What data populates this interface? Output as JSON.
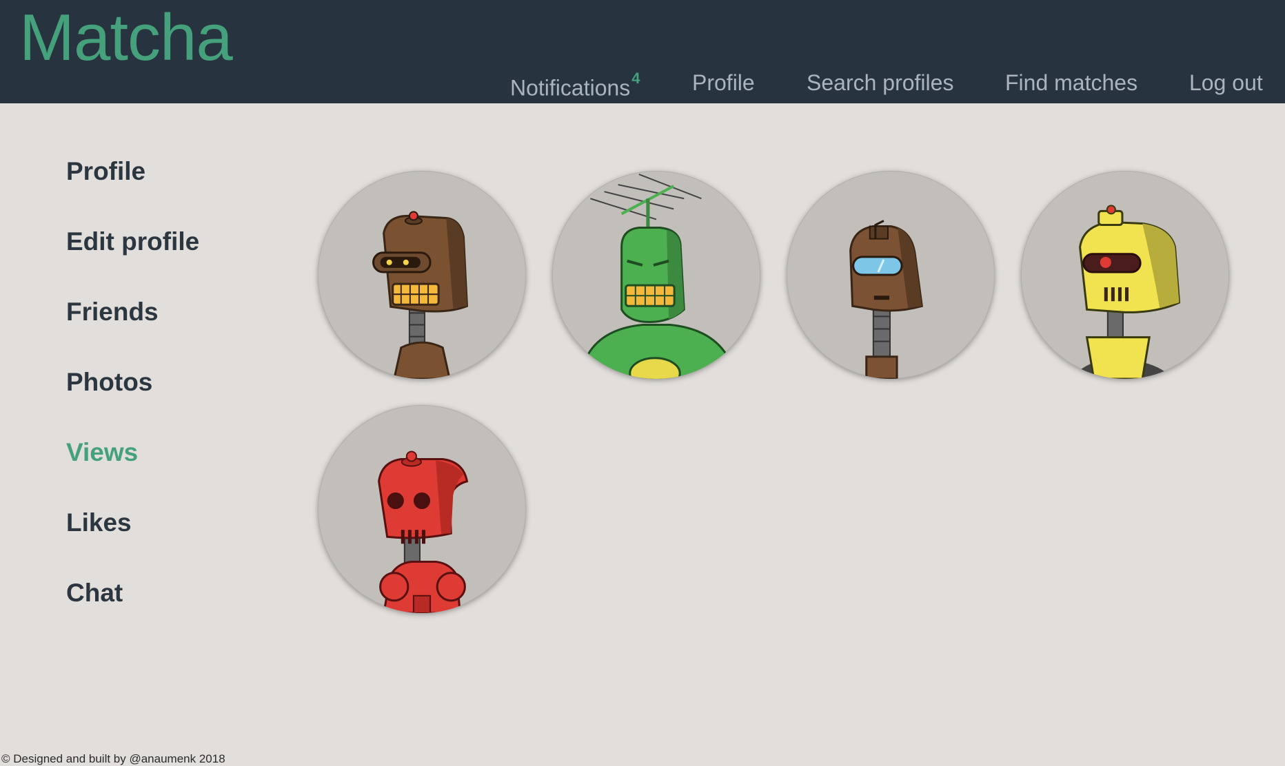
{
  "header": {
    "brand": "Matcha",
    "nav": {
      "notifications_label": "Notifications",
      "notifications_count": "4",
      "profile_label": "Profile",
      "search_label": "Search profiles",
      "find_matches_label": "Find matches",
      "logout_label": "Log out"
    }
  },
  "sidebar": {
    "items": [
      {
        "label": "Profile",
        "active": false
      },
      {
        "label": "Edit profile",
        "active": false
      },
      {
        "label": "Friends",
        "active": false
      },
      {
        "label": "Photos",
        "active": false
      },
      {
        "label": "Views",
        "active": true
      },
      {
        "label": "Likes",
        "active": false
      },
      {
        "label": "Chat",
        "active": false
      }
    ]
  },
  "viewers": [
    {
      "icon": "brown-robot-avatar-icon",
      "color": "#7a5232"
    },
    {
      "icon": "green-robot-antenna-avatar-icon",
      "color": "#4caf50"
    },
    {
      "icon": "brown-robot-visor-avatar-icon",
      "color": "#7b5233"
    },
    {
      "icon": "yellow-robot-avatar-icon",
      "color": "#f1e34f"
    },
    {
      "icon": "red-robot-avatar-icon",
      "color": "#dd3b33"
    }
  ],
  "colors": {
    "accent": "#44a17b",
    "header_bg": "#27333e",
    "page_bg": "#e1dedb",
    "nav_text": "#a9b4bd",
    "sidebar_text": "#2b3640"
  },
  "footer": {
    "text": "© Designed and built by @anaumenk 2018"
  }
}
